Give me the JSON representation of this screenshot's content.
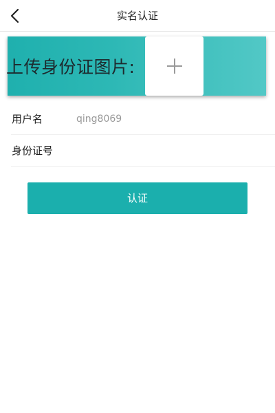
{
  "header": {
    "title": "实名认证",
    "back_icon": "chevron-left-icon"
  },
  "upload": {
    "label": "上传身份证图片:",
    "add_icon": "plus-icon"
  },
  "form": {
    "username": {
      "label": "用户名",
      "value": "qing8069"
    },
    "id_number": {
      "label": "身份证号",
      "value": ""
    }
  },
  "submit": {
    "label": "认证"
  },
  "colors": {
    "accent": "#1bafad",
    "banner_start": "#1fb0ae",
    "banner_end": "#52c8c6"
  }
}
